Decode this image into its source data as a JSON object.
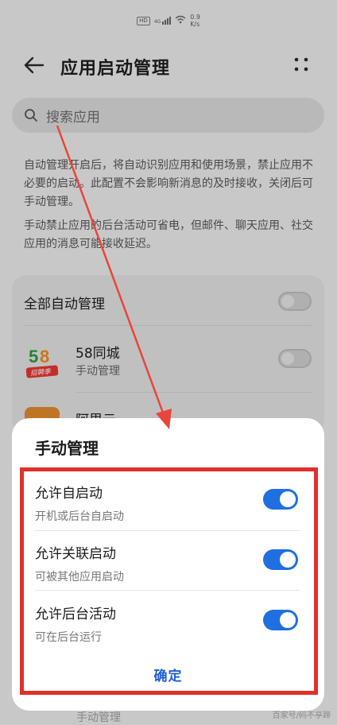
{
  "status_bar": {
    "hd": "HD",
    "signal": "4G",
    "speed_value": "0.9",
    "speed_unit": "K/s"
  },
  "header": {
    "title": "应用启动管理"
  },
  "search": {
    "placeholder": "搜索应用"
  },
  "description": {
    "para1": "自动管理开启后，将自动识别应用和使用场景，禁止应用不必要的启动。此配置不会影响新消息的及时接收，关闭后可手动管理。",
    "para2": "手动禁止应用的后台活动可省电，但邮件、聊天应用、社交应用的消息可能接收延迟。"
  },
  "list": {
    "all_auto_label": "全部自动管理",
    "apps": [
      {
        "name": "58同城",
        "status": "手动管理",
        "logo_text": "58",
        "logo_sub": "招聘季"
      },
      {
        "name": "阿里云",
        "status": ""
      }
    ]
  },
  "modal": {
    "title": "手动管理",
    "options": [
      {
        "title": "允许自启动",
        "subtitle": "开机或后台自启动",
        "enabled": true
      },
      {
        "title": "允许关联启动",
        "subtitle": "可被其他应用启动",
        "enabled": true
      },
      {
        "title": "允许后台活动",
        "subtitle": "可在后台运行",
        "enabled": true
      }
    ],
    "confirm_label": "确定"
  },
  "bottom": {
    "peek_text": "手动管理"
  },
  "watermark": "百家号/码不亭蹄",
  "colors": {
    "accent_blue": "#1f6fe0",
    "highlight_red": "#e0302a",
    "arrow_red": "#e8453c"
  }
}
